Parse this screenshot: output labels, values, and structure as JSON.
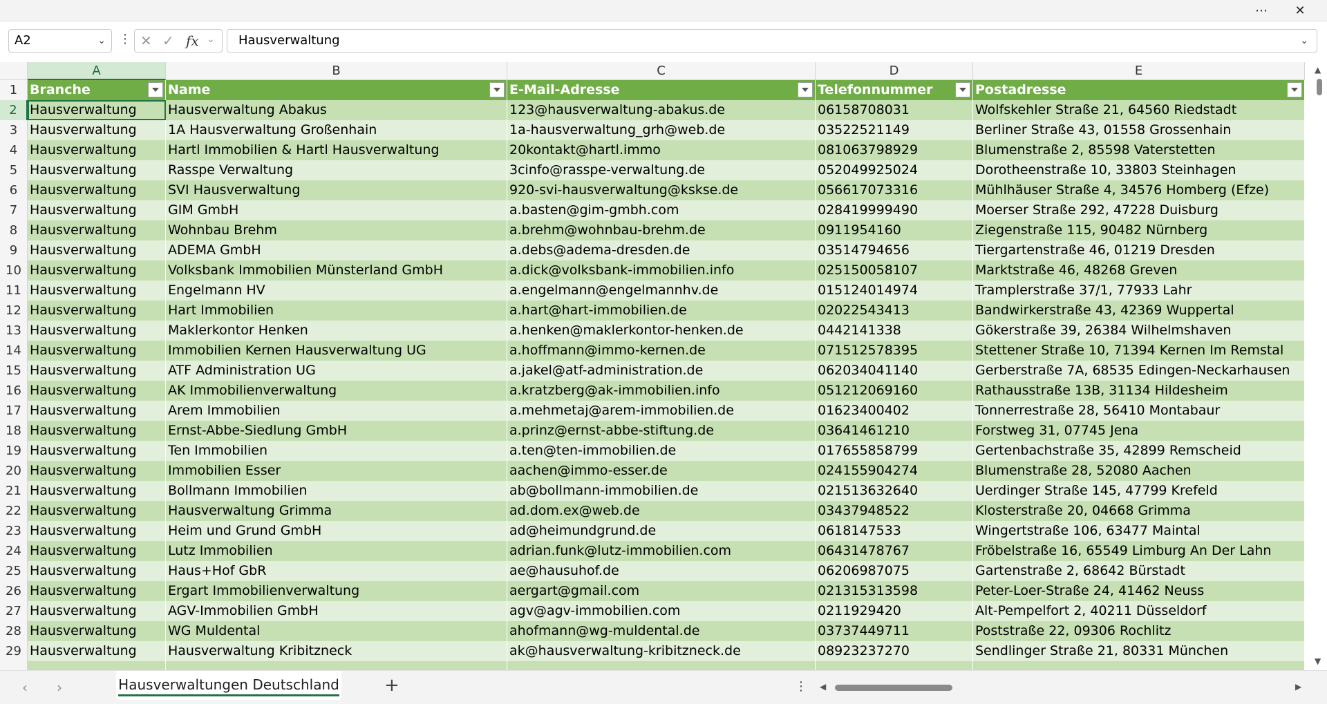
{
  "window": {
    "more_icon": "ellipsis-icon",
    "close_icon": "close-icon"
  },
  "formula_bar": {
    "name_box": "A2",
    "formula": "Hausverwaltung"
  },
  "columns": [
    "A",
    "B",
    "C",
    "D",
    "E"
  ],
  "header_row_number": "1",
  "headers": [
    "Branche",
    "Name",
    "E-Mail-Adresse",
    "Telefonnummer",
    "Postadresse"
  ],
  "rows": [
    {
      "n": "2",
      "a": "Hausverwaltung",
      "b": "Hausverwaltung Abakus",
      "c": "123@hausverwaltung-abakus.de",
      "d": "06158708031",
      "e": "Wolfskehler Straße 21, 64560 Riedstadt"
    },
    {
      "n": "3",
      "a": "Hausverwaltung",
      "b": "1A Hausverwaltung Großenhain",
      "c": "1a-hausverwaltung_grh@web.de",
      "d": "03522521149",
      "e": "Berliner Straße 43, 01558 Grossenhain"
    },
    {
      "n": "4",
      "a": "Hausverwaltung",
      "b": "Hartl Immobilien & Hartl Hausverwaltung",
      "c": "20kontakt@hartl.immo",
      "d": "081063798929",
      "e": "Blumenstraße 2, 85598 Vaterstetten"
    },
    {
      "n": "5",
      "a": "Hausverwaltung",
      "b": "Rasspe Verwaltung",
      "c": "3cinfo@rasspe-verwaltung.de",
      "d": "052049925024",
      "e": "Dorotheenstraße 10, 33803 Steinhagen"
    },
    {
      "n": "6",
      "a": "Hausverwaltung",
      "b": "SVI Hausverwaltung",
      "c": "920-svi-hausverwaltung@kskse.de",
      "d": "056617073316",
      "e": "Mühlhäuser Straße 4, 34576 Homberg (Efze)"
    },
    {
      "n": "7",
      "a": "Hausverwaltung",
      "b": "GIM GmbH",
      "c": "a.basten@gim-gmbh.com",
      "d": "028419999490",
      "e": "Moerser Straße 292, 47228 Duisburg"
    },
    {
      "n": "8",
      "a": "Hausverwaltung",
      "b": "Wohnbau Brehm",
      "c": "a.brehm@wohnbau-brehm.de",
      "d": "0911954160",
      "e": "Ziegenstraße 115, 90482 Nürnberg"
    },
    {
      "n": "9",
      "a": "Hausverwaltung",
      "b": "ADEMA GmbH",
      "c": "a.debs@adema-dresden.de",
      "d": "03514794656",
      "e": "Tiergartenstraße 46, 01219 Dresden"
    },
    {
      "n": "10",
      "a": "Hausverwaltung",
      "b": "Volksbank Immobilien Münsterland GmbH",
      "c": "a.dick@volksbank-immobilien.info",
      "d": "025150058107",
      "e": "Marktstraße 46, 48268 Greven"
    },
    {
      "n": "11",
      "a": "Hausverwaltung",
      "b": "Engelmann HV",
      "c": "a.engelmann@engelmannhv.de",
      "d": "015124014974",
      "e": "Tramplerstraße 37/1, 77933 Lahr"
    },
    {
      "n": "12",
      "a": "Hausverwaltung",
      "b": "Hart Immobilien",
      "c": "a.hart@hart-immobilien.de",
      "d": "02022543413",
      "e": "Bandwirkerstraße 43, 42369 Wuppertal"
    },
    {
      "n": "13",
      "a": "Hausverwaltung",
      "b": "Maklerkontor Henken",
      "c": "a.henken@maklerkontor-henken.de",
      "d": "0442141338",
      "e": "Gökerstraße 39, 26384 Wilhelmshaven"
    },
    {
      "n": "14",
      "a": "Hausverwaltung",
      "b": "Immobilien Kernen Hausverwaltung UG",
      "c": "a.hoffmann@immo-kernen.de",
      "d": "071512578395",
      "e": "Stettener Straße 10, 71394 Kernen Im Remstal"
    },
    {
      "n": "15",
      "a": "Hausverwaltung",
      "b": "ATF Administration UG",
      "c": "a.jakel@atf-administration.de",
      "d": "062034041140",
      "e": "Gerberstraße 7A, 68535 Edingen-Neckarhausen"
    },
    {
      "n": "16",
      "a": "Hausverwaltung",
      "b": "AK Immobilienverwaltung",
      "c": "a.kratzberg@ak-immobilien.info",
      "d": "051212069160",
      "e": "Rathausstraße 13B, 31134 Hildesheim"
    },
    {
      "n": "17",
      "a": "Hausverwaltung",
      "b": "Arem Immobilien",
      "c": "a.mehmetaj@arem-immobilien.de",
      "d": "01623400402",
      "e": "Tonnerrestraße 28, 56410 Montabaur"
    },
    {
      "n": "18",
      "a": "Hausverwaltung",
      "b": "Ernst-Abbe-Siedlung GmbH",
      "c": "a.prinz@ernst-abbe-stiftung.de",
      "d": "03641461210",
      "e": "Forstweg 31, 07745 Jena"
    },
    {
      "n": "19",
      "a": "Hausverwaltung",
      "b": "Ten Immobilien",
      "c": "a.ten@ten-immobilien.de",
      "d": "017655858799",
      "e": "Gertenbachstraße 35, 42899 Remscheid"
    },
    {
      "n": "20",
      "a": "Hausverwaltung",
      "b": "Immobilien Esser",
      "c": "aachen@immo-esser.de",
      "d": "024155904274",
      "e": "Blumenstraße 28, 52080 Aachen"
    },
    {
      "n": "21",
      "a": "Hausverwaltung",
      "b": "Bollmann Immobilien",
      "c": "ab@bollmann-immobilien.de",
      "d": "021513632640",
      "e": "Uerdinger Straße 145, 47799 Krefeld"
    },
    {
      "n": "22",
      "a": "Hausverwaltung",
      "b": "Hausverwaltung Grimma",
      "c": "ad.dom.ex@web.de",
      "d": "03437948522",
      "e": "Klosterstraße 20, 04668 Grimma"
    },
    {
      "n": "23",
      "a": "Hausverwaltung",
      "b": "Heim und Grund GmbH",
      "c": "ad@heimundgrund.de",
      "d": "0618147533",
      "e": "Wingertstraße 106, 63477 Maintal"
    },
    {
      "n": "24",
      "a": "Hausverwaltung",
      "b": "Lutz Immobilien",
      "c": "adrian.funk@lutz-immobilien.com",
      "d": "06431478767",
      "e": "Fröbelstraße 16, 65549 Limburg An Der Lahn"
    },
    {
      "n": "25",
      "a": "Hausverwaltung",
      "b": "Haus+Hof GbR",
      "c": "ae@hausuhof.de",
      "d": "06206987075",
      "e": "Gartenstraße 2, 68642 Bürstadt"
    },
    {
      "n": "26",
      "a": "Hausverwaltung",
      "b": "Ergart Immobilienverwaltung",
      "c": "aergart@gmail.com",
      "d": "021315313598",
      "e": "Peter-Loer-Straße 24, 41462 Neuss"
    },
    {
      "n": "27",
      "a": "Hausverwaltung",
      "b": "AGV-Immobilien GmbH",
      "c": "agv@agv-immobilien.com",
      "d": "0211929420",
      "e": "Alt-Pempelfort 2, 40211 Düsseldorf"
    },
    {
      "n": "28",
      "a": "Hausverwaltung",
      "b": "WG Muldental",
      "c": "ahofmann@wg-muldental.de",
      "d": "03737449711",
      "e": "Poststraße 22, 09306 Rochlitz"
    },
    {
      "n": "29",
      "a": "Hausverwaltung",
      "b": "Hausverwaltung Kribitzneck",
      "c": "ak@hausverwaltung-kribitzneck.de",
      "d": "08923237270",
      "e": "Sendlinger Straße 21, 80331 München"
    }
  ],
  "sheet": {
    "tab_label": "Hausverwaltungen Deutschland"
  },
  "colors": {
    "header_bg": "#70ad47",
    "row_dark": "#c6e0b4",
    "row_light": "#e2efda",
    "accent": "#217346"
  }
}
